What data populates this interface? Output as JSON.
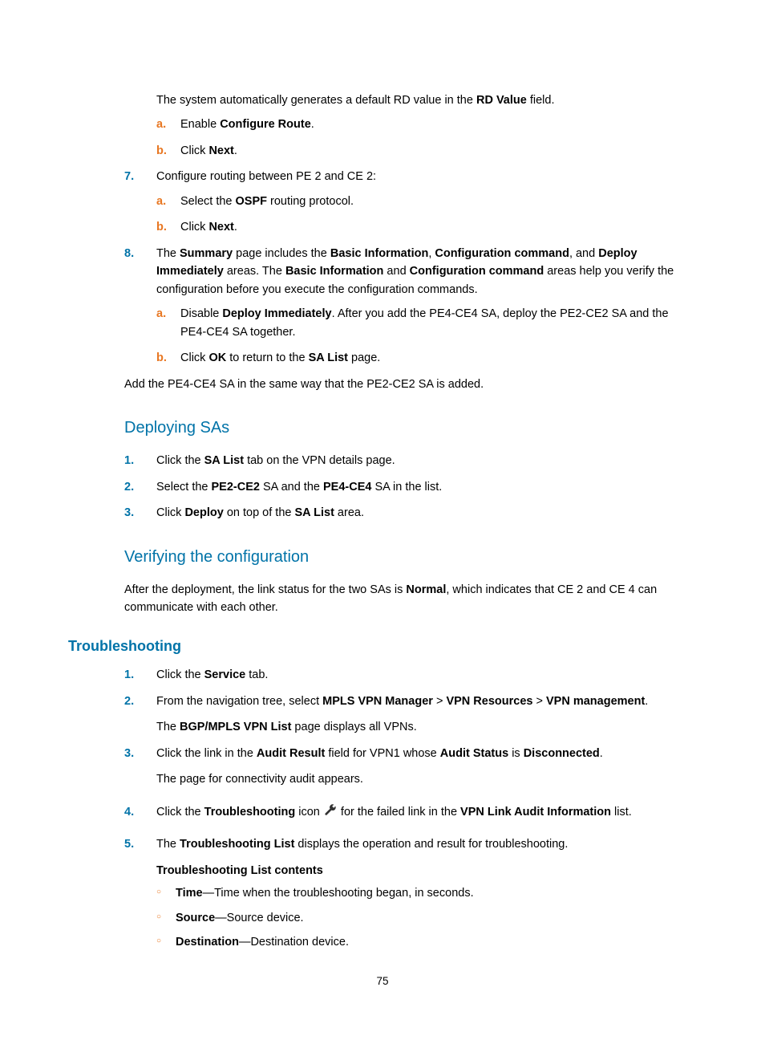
{
  "top": {
    "intro": {
      "pre": "The system automatically generates a default RD value in the ",
      "bold": "RD Value",
      "post": " field."
    },
    "a": {
      "pre": "Enable ",
      "bold": "Configure Route",
      "post": "."
    },
    "b": {
      "pre": "Click ",
      "bold": "Next",
      "post": "."
    }
  },
  "step7": {
    "title": "Configure routing between PE 2 and CE 2:",
    "a": {
      "pre": "Select the ",
      "bold": "OSPF",
      "post": " routing protocol."
    },
    "b": {
      "pre": "Click ",
      "bold": "Next",
      "post": "."
    }
  },
  "step8": {
    "p1": "The ",
    "p1b1": "Summary",
    "p2": " page includes the ",
    "p2b1": "Basic Information",
    "p3": ", ",
    "p3b1": "Configuration command",
    "p4": ", and ",
    "p4b1": "Deploy Immediately",
    "p5": " areas. The ",
    "p5b1": "Basic Information",
    "p6": " and ",
    "p6b1": "Configuration command",
    "p7": " areas help you verify the configuration before you execute the configuration commands.",
    "a": {
      "pre": "Disable ",
      "bold": "Deploy Immediately",
      "post": ". After you add the PE4-CE4 SA, deploy the PE2-CE2 SA and the PE4-CE4 SA together."
    },
    "b": {
      "pre": "Click ",
      "bold": "OK",
      "mid": " to return to the ",
      "bold2": "SA List",
      "post": " page."
    }
  },
  "addpara": "Add the PE4-CE4 SA in the same way that the PE2-CE2 SA is added.",
  "deploy": {
    "heading": "Deploying SAs",
    "s1": {
      "pre": "Click the ",
      "bold": "SA List",
      "post": " tab on the VPN details page."
    },
    "s2": {
      "pre": "Select the ",
      "b1": "PE2-CE2",
      "mid": " SA and the ",
      "b2": "PE4-CE4",
      "post": " SA in the list."
    },
    "s3": {
      "pre": "Click ",
      "b1": "Deploy",
      "mid": " on top of the ",
      "b2": "SA List",
      "post": " area."
    }
  },
  "verify": {
    "heading": "Verifying the configuration",
    "p1": "After the deployment, the link status for the two SAs is ",
    "b1": "Normal",
    "p2": ", which indicates that CE 2 and CE 4 can communicate with each other."
  },
  "trouble": {
    "heading": "Troubleshooting",
    "s1": {
      "pre": "Click the ",
      "bold": "Service",
      "post": " tab."
    },
    "s2": {
      "pre": "From the navigation tree, select ",
      "b1": "MPLS VPN Manager",
      "g1": " > ",
      "b2": "VPN Resources",
      "g2": " > ",
      "b3": "VPN management",
      "post": ".",
      "sub_pre": "The ",
      "sub_bold": "BGP/MPLS VPN List",
      "sub_post": " page displays all VPNs."
    },
    "s3": {
      "pre": "Click the link in the ",
      "b1": "Audit Result",
      "mid": " field for VPN1 whose ",
      "b2": "Audit Status",
      "mid2": " is ",
      "b3": "Disconnected",
      "post": ".",
      "sub": "The page for connectivity audit appears."
    },
    "s4": {
      "pre": "Click the ",
      "b1": "Troubleshooting",
      "mid": " icon ",
      "post_pre": " for the failed link in the ",
      "b2": "VPN Link Audit Information",
      "post": " list."
    },
    "s5": {
      "pre": "The ",
      "b1": "Troubleshooting List",
      "post": " displays the operation and result for troubleshooting.",
      "subheading": "Troubleshooting List contents",
      "items": {
        "time": {
          "bold": "Time",
          "text": "—Time when the troubleshooting began, in seconds."
        },
        "source": {
          "bold": "Source",
          "text": "—Source device."
        },
        "dest": {
          "bold": "Destination",
          "text": "—Destination device."
        }
      }
    }
  },
  "markers": {
    "n7": "7.",
    "n8": "8.",
    "n1": "1.",
    "n2": "2.",
    "n3": "3.",
    "n4": "4.",
    "n5": "5.",
    "a": "a.",
    "b": "b.",
    "circle": "○"
  },
  "pageNumber": "75"
}
